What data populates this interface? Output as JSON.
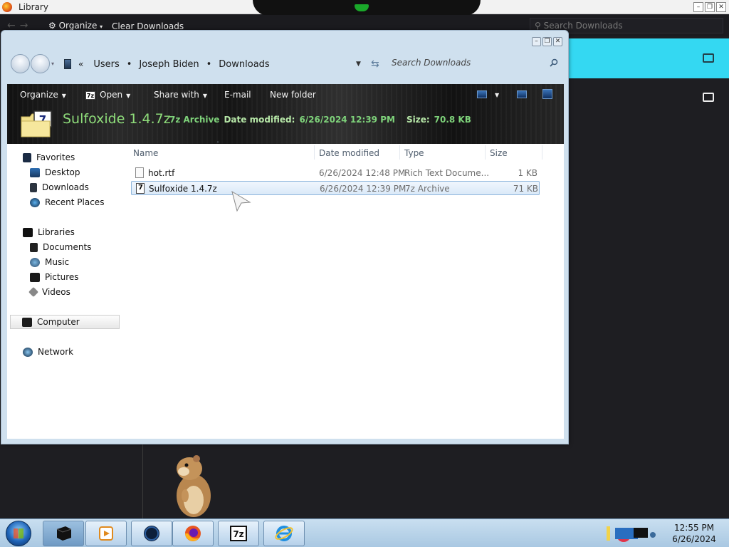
{
  "background_window": {
    "title": "Library",
    "organize_label": "Organize",
    "clear_label": "Clear Downloads",
    "search_placeholder": "Search Downloads"
  },
  "breadcrumb": {
    "items": [
      "Users",
      "Joseph Biden",
      "Downloads"
    ]
  },
  "search": {
    "placeholder": "Search Downloads"
  },
  "toolbar": {
    "organize": "Organize",
    "open": "Open",
    "share_with": "Share with",
    "email": "E-mail",
    "new_folder": "New folder"
  },
  "details_pane": {
    "name": "Sulfoxide 1.4.7z",
    "type": "7z Archive",
    "date_label": "Date modified:",
    "date_value": "6/26/2024 12:39 PM",
    "size_label": "Size:",
    "size_value": "70.8 KB"
  },
  "nav_pane": {
    "favorites": "Favorites",
    "desktop": "Desktop",
    "downloads": "Downloads",
    "recent_places": "Recent Places",
    "libraries": "Libraries",
    "documents": "Documents",
    "music": "Music",
    "pictures": "Pictures",
    "videos": "Videos",
    "computer": "Computer",
    "network": "Network"
  },
  "columns": {
    "name": "Name",
    "date_modified": "Date modified",
    "type": "Type",
    "size": "Size"
  },
  "files": [
    {
      "name": "hot.rtf",
      "date": "6/26/2024 12:48 PM",
      "type": "Rich Text Docume...",
      "size": "1 KB"
    },
    {
      "name": "Sulfoxide 1.4.7z",
      "date": "6/26/2024 12:39 PM",
      "type": "7z Archive",
      "size": "71 KB"
    }
  ],
  "clock": {
    "time": "12:55 PM",
    "date": "6/26/2024"
  },
  "colors": {
    "details_text": "#7ed27a",
    "taskbar": "#b6d1ea",
    "accent_cyan": "#34d8f2"
  }
}
